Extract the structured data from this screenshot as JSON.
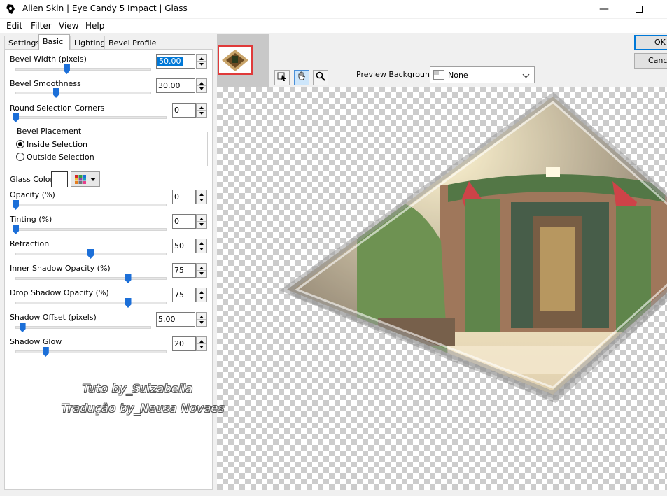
{
  "window": {
    "title": "Alien Skin | Eye Candy 5 Impact | Glass",
    "minimize_glyph": "—",
    "app_icon": "alien-skin-logo-icon",
    "maximize_icon": "maximize-icon"
  },
  "menu": [
    "Edit",
    "Filter",
    "View",
    "Help"
  ],
  "tabs": [
    "Settings",
    "Basic",
    "Lighting",
    "Bevel Profile"
  ],
  "active_tab": "Basic",
  "controls": {
    "bevel_width": {
      "label": "Bevel Width (pixels)",
      "value": "50.00",
      "level": 0.38
    },
    "bevel_smoothness": {
      "label": "Bevel Smoothness",
      "value": "30.00",
      "level": 0.3
    },
    "round_corners": {
      "label": "Round Selection Corners",
      "value": "0",
      "level": 0
    },
    "bevel_placement": {
      "title": "Bevel Placement",
      "options": [
        "Inside Selection",
        "Outside Selection"
      ],
      "selected": "Inside Selection"
    },
    "glass_color": {
      "label": "Glass Color",
      "swatch": "#ffffff",
      "picker_icon": "color-grid-icon"
    },
    "opacity": {
      "label": "Opacity (%)",
      "value": "0",
      "level": 0
    },
    "tinting": {
      "label": "Tinting (%)",
      "value": "0",
      "level": 0
    },
    "refraction": {
      "label": "Refraction",
      "value": "50",
      "level": 0.5
    },
    "inner_shadow_opacity": {
      "label": "Inner Shadow Opacity (%)",
      "value": "75",
      "level": 0.75
    },
    "drop_shadow_opacity": {
      "label": "Drop Shadow Opacity (%)",
      "value": "75",
      "level": 0.75
    },
    "shadow_offset": {
      "label": "Shadow Offset (pixels)",
      "value": "5.00",
      "level": 0.05
    },
    "shadow_glow": {
      "label": "Shadow Glow",
      "value": "20",
      "level": 0.2
    }
  },
  "preview": {
    "background_label": "Preview Background:",
    "background_value": "None",
    "tools": [
      "navigate-icon",
      "hand-icon",
      "zoom-icon"
    ]
  },
  "buttons": {
    "ok": "OK",
    "cancel": "Cancel"
  },
  "watermark": {
    "line1": "Tuto by_Suizabella",
    "line2": "Tradução by_Neusa Novaes"
  },
  "colors": {
    "accent": "#0078d7",
    "slider_thumb": "#1c6fd8",
    "thumbnail_border": "#e03a3a"
  }
}
